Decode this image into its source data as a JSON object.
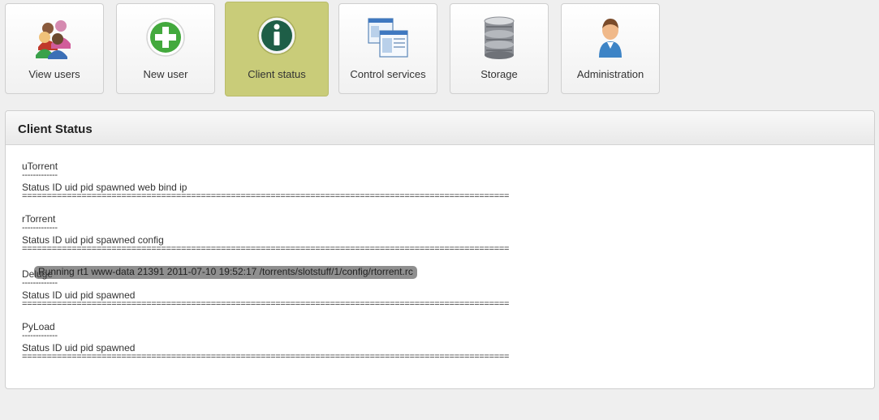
{
  "toolbar": {
    "items": [
      {
        "label": "View users",
        "icon": "users-icon"
      },
      {
        "label": "New user",
        "icon": "add-user-icon"
      },
      {
        "label": "Client status",
        "icon": "info-icon",
        "active": true
      },
      {
        "label": "Control services",
        "icon": "windows-icon"
      },
      {
        "label": "Storage",
        "icon": "database-icon"
      },
      {
        "label": "Administration",
        "icon": "admin-icon"
      }
    ],
    "active_color": "#c9cc79"
  },
  "panel": {
    "title": "Client Status",
    "clients": [
      {
        "name": "uTorrent",
        "dashes": "-------------",
        "header": "Status ID uid pid spawned web bind ip",
        "rule": "=================================================================================================="
      },
      {
        "name": "rTorrent",
        "dashes": "-------------",
        "header": "Status ID uid pid spawned config",
        "rule": "==================================================================================================",
        "running": "Running rt1 www-data 21391 2011-07-10 19:52:17 /torrents/slotstuff/1/config/rtorrent.rc"
      },
      {
        "name": "Deluge",
        "dashes": "-------------",
        "header": "Status ID uid pid spawned",
        "rule": "=================================================================================================="
      },
      {
        "name": "PyLoad",
        "dashes": "-------------",
        "header": "Status ID uid pid spawned",
        "rule": "=================================================================================================="
      }
    ]
  }
}
